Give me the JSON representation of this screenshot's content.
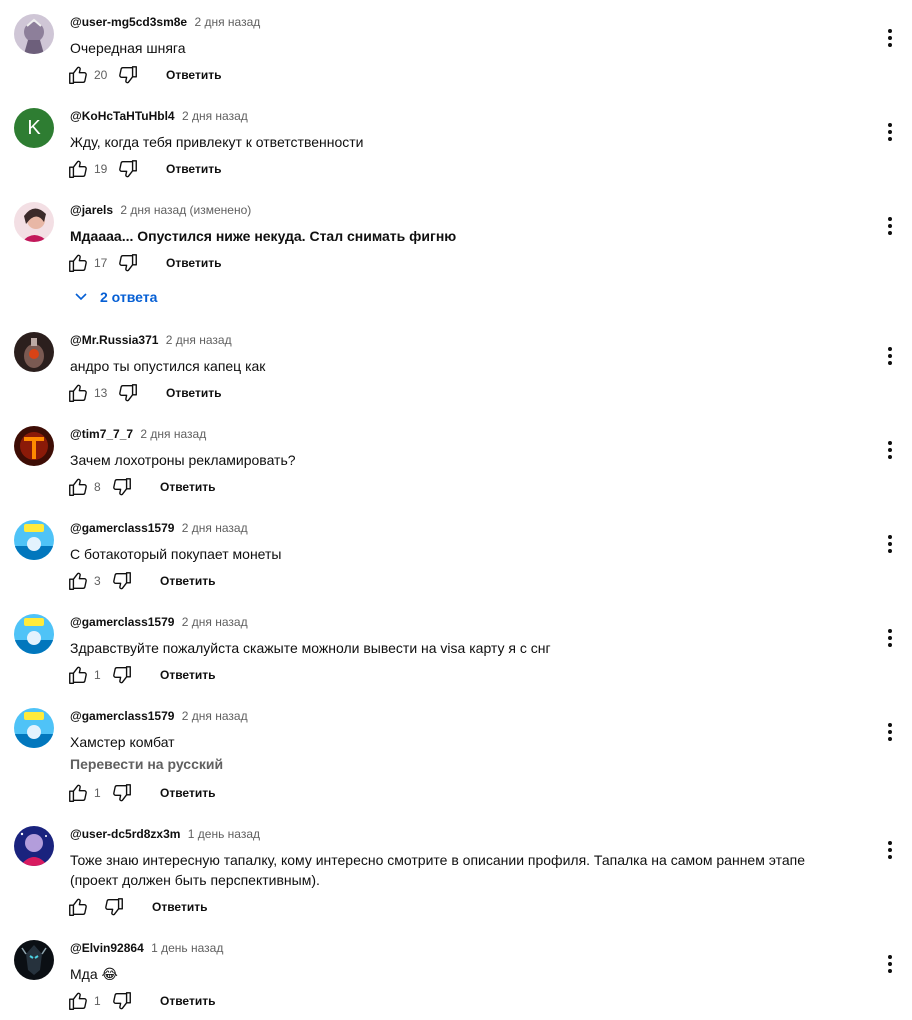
{
  "actions": {
    "reply_label": "Ответить"
  },
  "comments": [
    {
      "author": "@user-mg5cd3sm8e",
      "time": "2 дня назад",
      "text": "Очередная шняга",
      "likes": "20",
      "avatar": "knight"
    },
    {
      "author": "@KoHcTaHTuHbl4",
      "time": "2 дня назад",
      "text": "Жду, когда тебя привлекут к ответственности",
      "likes": "19",
      "avatar": "letter",
      "avatar_letter": "K",
      "avatar_color": "#2e7d32"
    },
    {
      "author": "@jarels",
      "time": "2 дня назад (изменено)",
      "text": "Мдаааа... Опустился ниже некуда. Стал снимать фигню",
      "likes": "17",
      "avatar": "face",
      "replies_label": "2 ответа"
    },
    {
      "author": "@Mr.Russia371",
      "time": "2 дня назад",
      "text": "андро ты опустился капец как",
      "likes": "13",
      "avatar": "lamp"
    },
    {
      "author": "@tim7_7_7",
      "time": "2 дня назад",
      "text": "Зачем лохотроны рекламировать?",
      "likes": "8",
      "avatar": "fire"
    },
    {
      "author": "@gamerclass1579",
      "time": "2 дня назад",
      "text": "С ботакоторый покупает монеты",
      "likes": "3",
      "avatar": "gamer",
      "avatar_badge": "GAMER"
    },
    {
      "author": "@gamerclass1579",
      "time": "2 дня назад",
      "text": "Здравствуйте пожалуйста скажыте можноли вывести на visa карту я с снг",
      "likes": "1",
      "avatar": "gamer",
      "avatar_badge": "GAMER"
    },
    {
      "author": "@gamerclass1579",
      "time": "2 дня назад",
      "text": "Хамстер комбат",
      "translate": "Перевести на русский",
      "likes": "1",
      "avatar": "gamer",
      "avatar_badge": "GAMER"
    },
    {
      "author": "@user-dc5rd8zx3m",
      "time": "1 день назад",
      "text": "Тоже знаю интересную тапалку, кому интересно смотрите в описании профиля. Тапалка на самом раннем этапе (проект должен быть перспективным).",
      "likes": "",
      "avatar": "astro"
    },
    {
      "author": "@Elvin92864",
      "time": "1 день назад",
      "text": "Мда 😂",
      "likes": "1",
      "avatar": "knight-dark"
    }
  ]
}
